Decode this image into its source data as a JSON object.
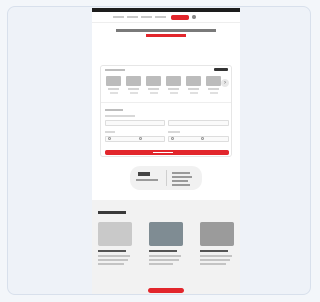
{
  "colors": {
    "brand_red": "#e2262c",
    "dark": "#1d1d1d",
    "page_bg": "#f3f6fa"
  },
  "header": {
    "logo_text": "",
    "nav_items": 4,
    "cta": ""
  },
  "icons": [
    "user-icon",
    "chevron-right-icon"
  ]
}
